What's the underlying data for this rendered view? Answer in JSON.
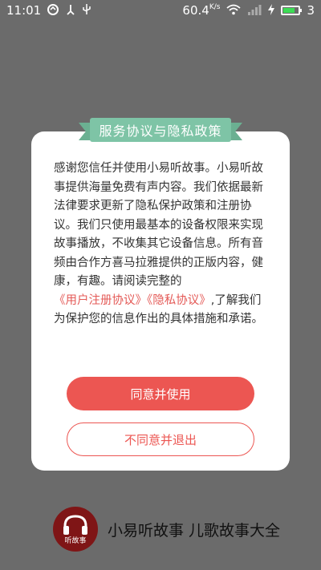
{
  "status_bar": {
    "time": "11:01",
    "speed": "60.4",
    "speed_unit": "K/s",
    "battery_level": "3",
    "battery_fraction": 0.75,
    "icons": [
      "sync-icon",
      "usb-icon",
      "wifi-icon",
      "signal-icon",
      "charging-icon",
      "battery-icon"
    ]
  },
  "dialog": {
    "title": "服务协议与隐私政策",
    "body_text": "感谢您信任并使用小易听故事。小易听故事提供海量免费有声内容。我们依据最新法律要求更新了隐私保护政策和注册协议。我们只使用最基本的设备权限来实现故事播放，不收集其它设备信息。所有音频由合作方喜马拉雅提供的正版内容，健康，有趣。请阅读完整的",
    "link_user_agreement": "《用户注册协议》",
    "link_privacy": "《隐私协议》",
    "body_tail": ",了解我们为保护您的信息作出的具体措施和承诺。",
    "agree_button": "同意并使用",
    "exit_button": "不同意并退出"
  },
  "branding": {
    "logo_text": "听故事",
    "app_name": "小易听故事 儿歌故事大全"
  },
  "colors": {
    "overlay": "#6b6b6b",
    "ribbon": "#7ec4a6",
    "accent": "#ec5652",
    "logo_bg": "#7f1516"
  }
}
